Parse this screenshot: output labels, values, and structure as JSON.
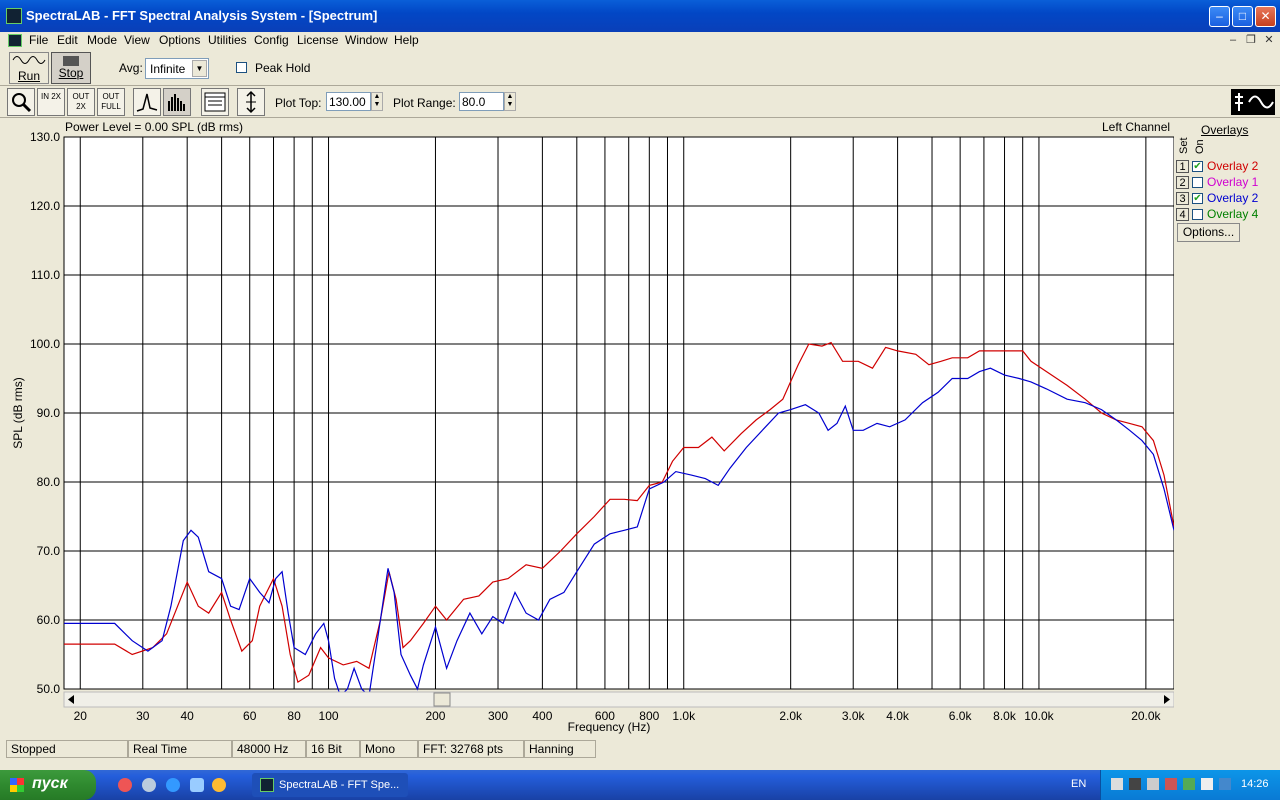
{
  "window": {
    "title": "SpectraLAB - FFT Spectral Analysis System - [Spectrum]"
  },
  "menu": [
    "File",
    "Edit",
    "Mode",
    "View",
    "Options",
    "Utilities",
    "Config",
    "License",
    "Window",
    "Help"
  ],
  "toolbar": {
    "run_label": "Run",
    "stop_label": "Stop",
    "avg_label": "Avg:",
    "avg_value": "Infinite",
    "peak_hold_label": "Peak Hold",
    "zoom_in_label": "IN 2X",
    "zoom_out_label": "OUT 2X",
    "zoom_full_label": "OUT FULL",
    "plot_top_label": "Plot Top:",
    "plot_top_value": "130.00",
    "plot_range_label": "Plot Range:",
    "plot_range_value": "80.0"
  },
  "plot": {
    "power_level": "Power Level = 0.00 SPL (dB rms)",
    "channel": "Left Channel"
  },
  "overlays": {
    "title": "Overlays",
    "set_header": "Set",
    "on_header": "On",
    "items": [
      {
        "num": "1",
        "checked": true,
        "label": "Overlay 2",
        "color": "#d00000"
      },
      {
        "num": "2",
        "checked": false,
        "label": "Overlay 1",
        "color": "#d000d0"
      },
      {
        "num": "3",
        "checked": true,
        "label": "Overlay 2",
        "color": "#0000d0"
      },
      {
        "num": "4",
        "checked": false,
        "label": "Overlay 4",
        "color": "#008000"
      }
    ],
    "options_label": "Options..."
  },
  "chart_data": {
    "type": "line",
    "xlabel": "Frequency (Hz)",
    "ylabel": "SPL (dB rms)",
    "x_scale": "log",
    "xlim": [
      18,
      24000
    ],
    "ylim": [
      50,
      130
    ],
    "grid": true,
    "y_ticks": [
      "50.0",
      "60.0",
      "70.0",
      "80.0",
      "90.0",
      "100.0",
      "110.0",
      "120.0",
      "130.0"
    ],
    "x_ticks": [
      {
        "v": 20,
        "l": "20"
      },
      {
        "v": 30,
        "l": "30"
      },
      {
        "v": 40,
        "l": "40"
      },
      {
        "v": 60,
        "l": "60"
      },
      {
        "v": 80,
        "l": "80"
      },
      {
        "v": 100,
        "l": "100"
      },
      {
        "v": 200,
        "l": "200"
      },
      {
        "v": 300,
        "l": "300"
      },
      {
        "v": 400,
        "l": "400"
      },
      {
        "v": 600,
        "l": "600"
      },
      {
        "v": 800,
        "l": "800"
      },
      {
        "v": 1000,
        "l": "1.0k"
      },
      {
        "v": 2000,
        "l": "2.0k"
      },
      {
        "v": 3000,
        "l": "3.0k"
      },
      {
        "v": 4000,
        "l": "4.0k"
      },
      {
        "v": 6000,
        "l": "6.0k"
      },
      {
        "v": 8000,
        "l": "8.0k"
      },
      {
        "v": 10000,
        "l": "10.0k"
      },
      {
        "v": 20000,
        "l": "20.0k"
      }
    ],
    "gridlines_x": [
      20,
      30,
      40,
      50,
      60,
      70,
      80,
      90,
      100,
      200,
      300,
      400,
      500,
      600,
      700,
      800,
      900,
      1000,
      2000,
      3000,
      4000,
      5000,
      6000,
      7000,
      8000,
      9000,
      10000,
      20000
    ],
    "series": [
      {
        "color": "#d00000",
        "points": [
          [
            18,
            56.5
          ],
          [
            25,
            56.5
          ],
          [
            28,
            55
          ],
          [
            32,
            56
          ],
          [
            35,
            58
          ],
          [
            40,
            65.5
          ],
          [
            43,
            62
          ],
          [
            46,
            61
          ],
          [
            50,
            64
          ],
          [
            53,
            60
          ],
          [
            57,
            55.5
          ],
          [
            61,
            57
          ],
          [
            64,
            62
          ],
          [
            70,
            66
          ],
          [
            74,
            62
          ],
          [
            78,
            55
          ],
          [
            82,
            51
          ],
          [
            88,
            52
          ],
          [
            95,
            56
          ],
          [
            100,
            54.5
          ],
          [
            110,
            53.5
          ],
          [
            120,
            54
          ],
          [
            130,
            53
          ],
          [
            140,
            60
          ],
          [
            148,
            67
          ],
          [
            155,
            63
          ],
          [
            162,
            56
          ],
          [
            170,
            57
          ],
          [
            185,
            59.5
          ],
          [
            200,
            62
          ],
          [
            215,
            60
          ],
          [
            240,
            63
          ],
          [
            265,
            63.5
          ],
          [
            290,
            65.5
          ],
          [
            320,
            66
          ],
          [
            360,
            68
          ],
          [
            400,
            67.5
          ],
          [
            450,
            70
          ],
          [
            500,
            72.5
          ],
          [
            560,
            75
          ],
          [
            620,
            77.5
          ],
          [
            680,
            77.5
          ],
          [
            740,
            77.3
          ],
          [
            800,
            79.5
          ],
          [
            870,
            80
          ],
          [
            930,
            83
          ],
          [
            1000,
            85
          ],
          [
            1100,
            85
          ],
          [
            1200,
            86.5
          ],
          [
            1300,
            84.5
          ],
          [
            1450,
            87
          ],
          [
            1600,
            89
          ],
          [
            1750,
            90.5
          ],
          [
            1900,
            92
          ],
          [
            2100,
            97
          ],
          [
            2250,
            100
          ],
          [
            2450,
            99.7
          ],
          [
            2600,
            100.2
          ],
          [
            2800,
            97.5
          ],
          [
            3100,
            97.5
          ],
          [
            3400,
            96.5
          ],
          [
            3700,
            99.5
          ],
          [
            4000,
            99
          ],
          [
            4500,
            98.5
          ],
          [
            4900,
            97
          ],
          [
            5300,
            97.5
          ],
          [
            5700,
            98
          ],
          [
            6300,
            98
          ],
          [
            6800,
            99
          ],
          [
            7500,
            99
          ],
          [
            8300,
            99
          ],
          [
            9000,
            99
          ],
          [
            9500,
            97.5
          ],
          [
            10500,
            96
          ],
          [
            12000,
            94
          ],
          [
            13500,
            92
          ],
          [
            15000,
            90
          ],
          [
            16500,
            89
          ],
          [
            18000,
            88.5
          ],
          [
            19500,
            88
          ],
          [
            21000,
            86
          ],
          [
            22500,
            81
          ],
          [
            24000,
            73.5
          ]
        ]
      },
      {
        "color": "#0000d0",
        "points": [
          [
            18,
            59.5
          ],
          [
            25,
            59.5
          ],
          [
            28,
            57
          ],
          [
            31,
            55.5
          ],
          [
            34,
            57
          ],
          [
            36,
            62
          ],
          [
            39,
            71.5
          ],
          [
            41,
            73
          ],
          [
            43,
            72
          ],
          [
            46,
            67
          ],
          [
            50,
            66
          ],
          [
            53,
            62
          ],
          [
            56,
            61.5
          ],
          [
            60,
            66
          ],
          [
            64,
            64
          ],
          [
            68,
            62.5
          ],
          [
            71,
            66
          ],
          [
            74,
            67
          ],
          [
            77,
            61
          ],
          [
            80,
            56
          ],
          [
            86,
            55
          ],
          [
            92,
            58
          ],
          [
            97,
            59.5
          ],
          [
            100,
            57
          ],
          [
            104,
            51.5
          ],
          [
            108,
            49
          ],
          [
            113,
            50
          ],
          [
            118,
            53
          ],
          [
            124,
            50
          ],
          [
            130,
            49
          ],
          [
            140,
            60
          ],
          [
            147,
            67.5
          ],
          [
            153,
            64
          ],
          [
            160,
            55
          ],
          [
            170,
            52
          ],
          [
            178,
            50
          ],
          [
            185,
            53.5
          ],
          [
            200,
            59
          ],
          [
            215,
            53
          ],
          [
            230,
            57
          ],
          [
            250,
            61
          ],
          [
            270,
            58
          ],
          [
            290,
            60.5
          ],
          [
            310,
            59.5
          ],
          [
            335,
            64
          ],
          [
            360,
            61
          ],
          [
            390,
            60
          ],
          [
            420,
            63
          ],
          [
            460,
            64
          ],
          [
            500,
            67
          ],
          [
            560,
            71
          ],
          [
            620,
            72.5
          ],
          [
            680,
            73
          ],
          [
            740,
            73.5
          ],
          [
            800,
            79
          ],
          [
            880,
            80
          ],
          [
            950,
            81.5
          ],
          [
            1050,
            81
          ],
          [
            1150,
            80.5
          ],
          [
            1250,
            79.5
          ],
          [
            1350,
            82
          ],
          [
            1500,
            85
          ],
          [
            1700,
            88
          ],
          [
            1850,
            90
          ],
          [
            2000,
            90.5
          ],
          [
            2200,
            91.2
          ],
          [
            2400,
            90
          ],
          [
            2550,
            87.5
          ],
          [
            2700,
            88.5
          ],
          [
            2850,
            91
          ],
          [
            3000,
            87.5
          ],
          [
            3200,
            87.5
          ],
          [
            3500,
            88.5
          ],
          [
            3800,
            88
          ],
          [
            4200,
            89
          ],
          [
            4700,
            91.5
          ],
          [
            5200,
            93
          ],
          [
            5700,
            95
          ],
          [
            6300,
            95
          ],
          [
            6800,
            96
          ],
          [
            7300,
            96.5
          ],
          [
            8000,
            95.5
          ],
          [
            8800,
            95
          ],
          [
            9500,
            94.5
          ],
          [
            10500,
            93.5
          ],
          [
            12000,
            92
          ],
          [
            13500,
            91.5
          ],
          [
            15000,
            90.5
          ],
          [
            16500,
            89
          ],
          [
            18000,
            87.5
          ],
          [
            19500,
            86
          ],
          [
            21000,
            84
          ],
          [
            22500,
            79
          ],
          [
            24000,
            73
          ]
        ]
      }
    ]
  },
  "status": {
    "state": "Stopped",
    "mode": "Real Time",
    "rate": "48000 Hz",
    "bits": "16 Bit",
    "channels": "Mono",
    "fft": "FFT: 32768 pts",
    "window": "Hanning"
  },
  "taskbar": {
    "start": "пуск",
    "task_label": "SpectraLAB - FFT Spe...",
    "lang": "EN",
    "clock": "14:26"
  }
}
